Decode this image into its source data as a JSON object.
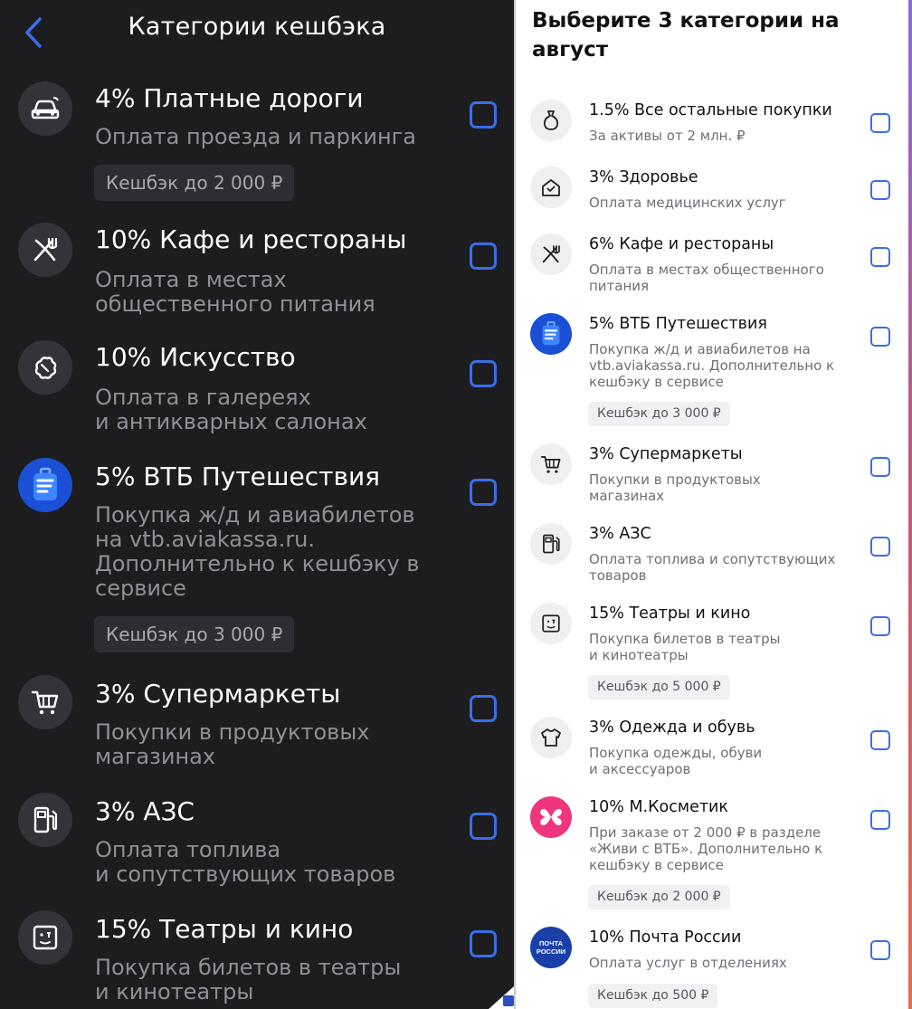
{
  "left": {
    "title": "Категории кешбэка",
    "items": [
      {
        "title": "4% Платные дороги",
        "desc": "Оплата проезда и паркинга",
        "badge": "Кешбэк до 2 000 ₽",
        "icon": "car-icon"
      },
      {
        "title": "10% Кафе и рестораны",
        "desc": "Оплата в местах\nобщественного питания",
        "badge": "",
        "icon": "fork-knife-icon"
      },
      {
        "title": "10% Искусство",
        "desc": "Оплата в галереях\nи антикварных салонах",
        "badge": "",
        "icon": "palette-icon"
      },
      {
        "title": "5% ВТБ Путешествия",
        "desc": "Покупка ж/д и авиабилетов\nна vtb.aviakassa.ru.\nДополнительно к кешбэку в\nсервисе",
        "badge": "Кешбэк до 3 000 ₽",
        "icon": "suitcase-icon"
      },
      {
        "title": "3% Супермаркеты",
        "desc": "Покупки в продуктовых\nмагазинах",
        "badge": "",
        "icon": "cart-icon"
      },
      {
        "title": "3% АЗС",
        "desc": "Оплата топлива\nи сопутствующих товаров",
        "badge": "",
        "icon": "fuel-icon"
      },
      {
        "title": "15% Театры и кино",
        "desc": "Покупка билетов в театры\nи кинотеатры",
        "badge": "",
        "icon": "theater-icon"
      }
    ]
  },
  "right": {
    "title": "Выберите 3 категории на август",
    "items": [
      {
        "title": "1.5% Все остальные покупки",
        "desc": "За активы от 2 млн. ₽",
        "badge": "",
        "icon": "bag-icon"
      },
      {
        "title": "3% Здоровье",
        "desc": "Оплата медицинских услуг",
        "badge": "",
        "icon": "health-icon"
      },
      {
        "title": "6% Кафе и рестораны",
        "desc": "Оплата в местах общественного\nпитания",
        "badge": "",
        "icon": "fork-knife-icon"
      },
      {
        "title": "5% ВТБ Путешествия",
        "desc": "Покупка ж/д и авиабилетов на\nvtb.aviakassa.ru. Дополнительно к\nкешбэку в сервисе",
        "badge": "Кешбэк до 3 000 ₽",
        "icon": "suitcase-icon"
      },
      {
        "title": "3% Супермаркеты",
        "desc": "Покупки в продуктовых\nмагазинах",
        "badge": "",
        "icon": "cart-icon"
      },
      {
        "title": "3% АЗС",
        "desc": "Оплата топлива и сопутствующих\nтоваров",
        "badge": "",
        "icon": "fuel-icon"
      },
      {
        "title": "15% Театры и кино",
        "desc": "Покупка билетов в театры\nи кинотеатры",
        "badge": "Кешбэк до 5 000 ₽",
        "icon": "theater-icon"
      },
      {
        "title": "3% Одежда и обувь",
        "desc": "Покупка одежды, обуви\nи аксессуаров",
        "badge": "",
        "icon": "tshirt-icon"
      },
      {
        "title": "10% М.Косметик",
        "desc": "При заказе от 2 000 ₽ в разделе\n«Живи с ВТБ». Дополнительно к\nкешбэку в сервисе",
        "badge": "Кешбэк до 2 000 ₽",
        "icon": "butterfly-icon"
      },
      {
        "title": "10% Почта России",
        "desc": "Оплата услуг в отделениях",
        "badge": "Кешбэк до 500 ₽",
        "icon": "russian-post-logo",
        "logo_text": "ПОЧТА РОССИИ"
      }
    ]
  },
  "colors": {
    "accent": "#3a6ee8",
    "dark_bg": "#1d1d20",
    "vtb_blue": "#1a4fd6",
    "kosmetik_pink": "#f0357f",
    "post_blue": "#1a3fa8"
  }
}
